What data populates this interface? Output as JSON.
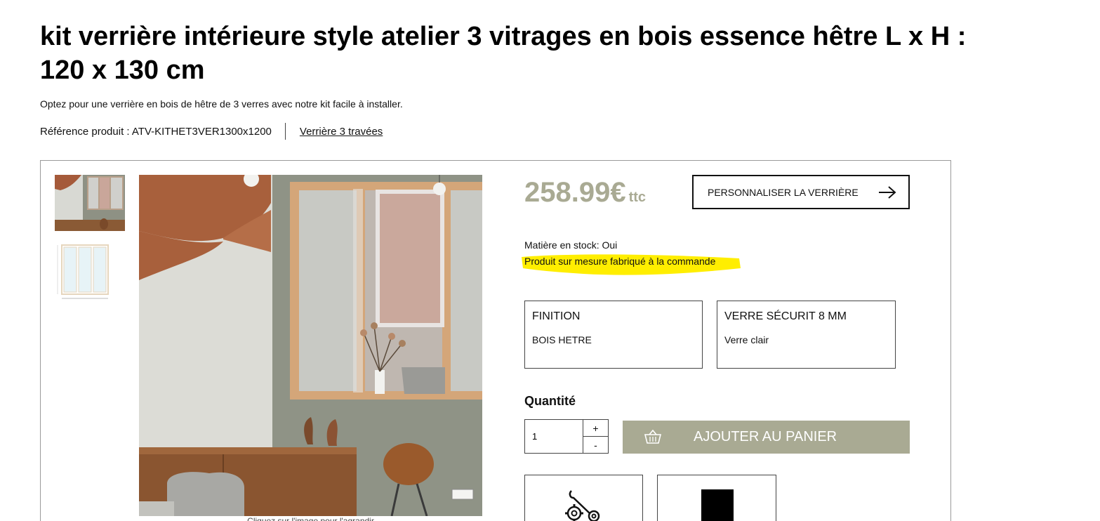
{
  "product": {
    "title": "kit verrière intérieure style atelier 3 vitrages en bois essence hêtre L x H : 120 x 130 cm",
    "subtitle": "Optez pour une verrière en bois de hêtre de 3 verres avec notre kit facile à installer.",
    "reference": "Référence produit : ATV-KITHET3VER1300x1200",
    "category_link": "Verrière 3 travées"
  },
  "gallery": {
    "caption": "Cliquez sur l'image pour l'agrandir"
  },
  "pricing": {
    "amount": "258.99€",
    "tax": "ttc"
  },
  "customize_button": {
    "label": "PERSONNALISER LA VERRIÈRE",
    "icon": "arrow-right-icon"
  },
  "availability": {
    "stock": "Matière en stock: Oui",
    "made_to_order": "Produit sur mesure fabriqué à la commande",
    "highlight_color": "#ffee00"
  },
  "options": [
    {
      "title": "FINITION",
      "value": "BOIS HETRE"
    },
    {
      "title": "VERRE SÉCURIT 8 MM",
      "value": "Verre clair"
    }
  ],
  "quantity": {
    "label": "Quantité",
    "value": "1",
    "plus": "+",
    "minus": "-"
  },
  "cart": {
    "label": "AJOUTER AU PANIER",
    "icon": "basket-icon",
    "color": "#a9aa93"
  },
  "tiles": [
    {
      "icon": "tools-icon"
    },
    {
      "icon": "black-square-icon"
    }
  ]
}
